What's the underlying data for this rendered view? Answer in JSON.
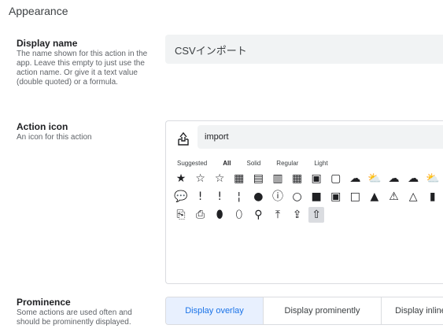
{
  "section_title": "Appearance",
  "display_name": {
    "label": "Display name",
    "description": "The name shown for this action in the app. Leave this empty to just use the action name. Or give it a text value (double quoted) or a formula.",
    "value": "CSVインポート"
  },
  "action_icon": {
    "label": "Action icon",
    "description": "An icon for this action",
    "search_value": "import",
    "tabs": [
      "Suggested",
      "All",
      "Solid",
      "Regular",
      "Light"
    ],
    "active_tab": "All",
    "icon_rows": [
      [
        {
          "name": "star-solid-icon",
          "glyph": "★"
        },
        {
          "name": "star-regular-icon",
          "glyph": "☆"
        },
        {
          "name": "star-light-icon",
          "glyph": "☆"
        },
        {
          "name": "calendar-star-solid-icon",
          "glyph": "▦"
        },
        {
          "name": "calendar-exclamation-regular-icon",
          "glyph": "▤"
        },
        {
          "name": "calendar-exclamation-light-icon",
          "glyph": "▥"
        },
        {
          "name": "calendar-star-regular-icon",
          "glyph": "▦"
        },
        {
          "name": "calendar-check-icon",
          "glyph": "▣"
        },
        {
          "name": "calendar-light-icon",
          "glyph": "▢"
        },
        {
          "name": "cloud-upload-solid-icon",
          "glyph": "☁"
        },
        {
          "name": "cloud-upload-regular-icon",
          "glyph": "⛅"
        },
        {
          "name": "cloud-upload-light-icon",
          "glyph": "☁"
        },
        {
          "name": "cloud-upload-solid-2-icon",
          "glyph": "☁"
        },
        {
          "name": "cloud-upload-regular-2-icon",
          "glyph": "⛅"
        },
        {
          "name": "cloud-upload-light-2-icon",
          "glyph": "☁"
        }
      ],
      [
        {
          "name": "comment-exclamation-icon",
          "glyph": "💬"
        },
        {
          "name": "exclamation-solid-icon",
          "glyph": "!"
        },
        {
          "name": "exclamation-regular-icon",
          "glyph": "ǃ"
        },
        {
          "name": "exclamation-light-icon",
          "glyph": "¦"
        },
        {
          "name": "exclamation-circle-solid-icon",
          "glyph": "●"
        },
        {
          "name": "exclamation-circle-regular-icon",
          "glyph": "ⓘ"
        },
        {
          "name": "exclamation-circle-light-icon",
          "glyph": "○"
        },
        {
          "name": "exclamation-square-solid-icon",
          "glyph": "■"
        },
        {
          "name": "exclamation-square-regular-icon",
          "glyph": "▣"
        },
        {
          "name": "exclamation-square-light-icon",
          "glyph": "□"
        },
        {
          "name": "exclamation-triangle-solid-icon",
          "glyph": "▲"
        },
        {
          "name": "exclamation-triangle-regular-icon",
          "glyph": "⚠"
        },
        {
          "name": "exclamation-triangle-light-icon",
          "glyph": "△"
        },
        {
          "name": "file-exclamation-solid-icon",
          "glyph": "▮"
        },
        {
          "name": "file-exclamation-regular-icon",
          "glyph": "▯"
        }
      ],
      [
        {
          "name": "file-import-regular-icon",
          "glyph": "⎘"
        },
        {
          "name": "file-import-light-icon",
          "glyph": "⎙"
        },
        {
          "name": "map-marker-exclamation-solid-icon",
          "glyph": "⬮"
        },
        {
          "name": "map-marker-exclamation-regular-icon",
          "glyph": "⬯"
        },
        {
          "name": "map-marker-exclamation-light-icon",
          "glyph": "⚲"
        },
        {
          "name": "upload-solid-icon",
          "glyph": "⤒"
        },
        {
          "name": "file-upload-regular-icon",
          "glyph": "⇪"
        },
        {
          "name": "file-upload-light-icon",
          "glyph": "⇧"
        }
      ]
    ],
    "selected_icon": "file-upload-light-icon"
  },
  "prominence": {
    "label": "Prominence",
    "description": "Some actions are used often and should be prominently displayed.",
    "options": [
      "Display overlay",
      "Display prominently",
      "Display inline"
    ],
    "selected": "Display overlay"
  }
}
